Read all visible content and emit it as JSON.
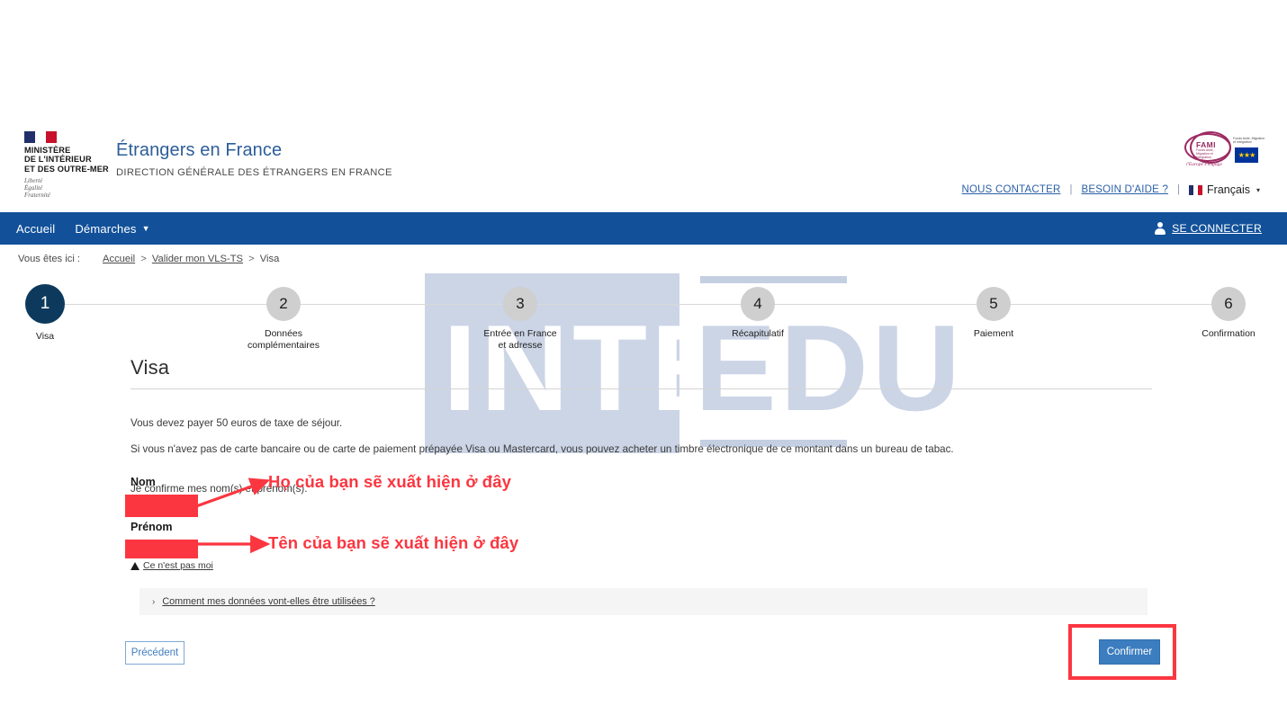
{
  "header": {
    "logo": {
      "ministry_lines": [
        "MINISTÈRE",
        "DE L'INTÉRIEUR",
        "ET DES OUTRE-MER"
      ],
      "motto_lines": [
        "Liberté",
        "Égalité",
        "Fraternité"
      ],
      "flag_icon": "french-flag-icon"
    },
    "site_title": "Étrangers en France",
    "site_subtitle": "DIRECTION GÉNÉRALE DES ÉTRANGERS EN FRANCE",
    "fami": {
      "word": "FAMI",
      "subtitle": "Fonds Asile, Migration et Intégration",
      "right_text": "Fonds Asile, Migration et Intégration",
      "motto": "l'Europe s'engage",
      "eu_flag_icon": "eu-flag-icon"
    },
    "links": {
      "contact": "NOUS CONTACTER",
      "help": "BESOIN D'AIDE ?",
      "separator": "|",
      "language": "Français",
      "language_caret": "▾"
    }
  },
  "nav": {
    "items": [
      {
        "label": "Accueil",
        "has_caret": false
      },
      {
        "label": "Démarches",
        "has_caret": true,
        "caret": "▼"
      }
    ],
    "login": "SE CONNECTER",
    "avatar_icon": "user-avatar-icon"
  },
  "breadcrumb": {
    "label": "Vous êtes ici :",
    "items": [
      "Accueil",
      "Valider mon VLS-TS",
      "Visa"
    ],
    "separator": ">"
  },
  "stepper": {
    "steps": [
      {
        "number": "1",
        "label": "Visa",
        "state": "active"
      },
      {
        "number": "2",
        "label": "Données\ncomplémentaires",
        "state": "idle"
      },
      {
        "number": "3",
        "label": "Entrée en France\net adresse",
        "state": "idle"
      },
      {
        "number": "4",
        "label": "Récapitulatif",
        "state": "idle"
      },
      {
        "number": "5",
        "label": "Paiement",
        "state": "idle"
      },
      {
        "number": "6",
        "label": "Confirmation",
        "state": "idle"
      }
    ]
  },
  "main": {
    "heading": "Visa",
    "paragraph_1": "Vous devez payer 50 euros de taxe de séjour.",
    "paragraph_2": "Si vous n'avez pas de carte bancaire ou de carte de paiement prépayée Visa ou Mastercard, vous pouvez acheter un timbre électronique de ce montant dans un bureau de tabac.",
    "paragraph_3": "Je confirme mes nom(s) et prénom(s).",
    "fields": {
      "nom_label": "Nom",
      "nom_value": "",
      "prenom_label": "Prénom",
      "prenom_value": ""
    },
    "not_me_link": "Ce n'est pas moi",
    "warning_icon": "warning-triangle-icon",
    "accordion": {
      "arrow": "›",
      "label": "Comment mes données vont-elles être utilisées ?"
    },
    "buttons": {
      "previous": "Précédent",
      "confirm": "Confirmer"
    }
  },
  "annotations": {
    "nom_note": "Họ của bạn sẽ xuất hiện ở đây",
    "prenom_note": "Tên của bạn sẽ xuất hiện ở đây",
    "color": "#fb3640"
  },
  "watermark": {
    "word_1": "INTER",
    "word_2": "EDU"
  },
  "colors": {
    "nav_blue": "#12519a",
    "step_active": "#0d3a5c",
    "link_blue": "#2b5fa8",
    "confirm_blue": "#3b7dbf",
    "annotation_red": "#fb3640"
  }
}
